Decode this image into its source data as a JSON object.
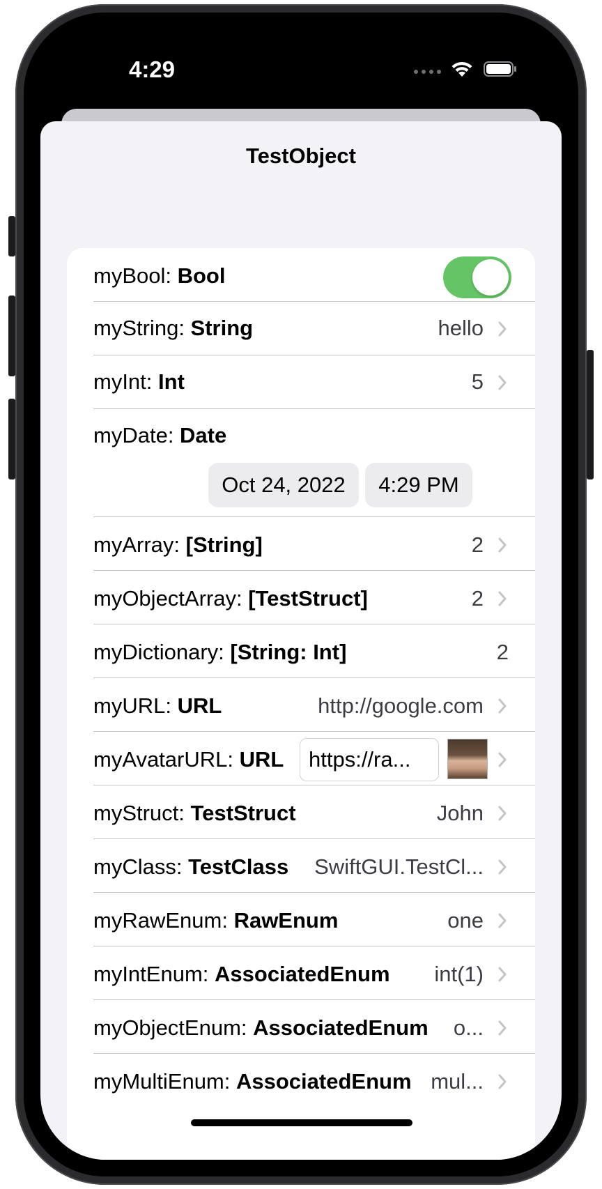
{
  "status_bar": {
    "time": "4:29"
  },
  "nav": {
    "title": "TestObject"
  },
  "rows": [
    {
      "name": "myBool",
      "type": "Bool",
      "kind": "toggle",
      "on": true
    },
    {
      "name": "myString",
      "type": "String",
      "value": "hello"
    },
    {
      "name": "myInt",
      "type": "Int",
      "value": "5"
    },
    {
      "name": "myDate",
      "type": "Date",
      "date": "Oct 24, 2022",
      "time": "4:29 PM"
    },
    {
      "name": "myArray",
      "type": "[String]",
      "value": "2"
    },
    {
      "name": "myObjectArray",
      "type": "[TestStruct]",
      "value": "2"
    },
    {
      "name": "myDictionary",
      "type": "[String: Int]",
      "value": "2"
    },
    {
      "name": "myURL",
      "type": "URL",
      "value": "http://google.com"
    },
    {
      "name": "myAvatarURL",
      "type": "URL",
      "value": "https://ra..."
    },
    {
      "name": "myStruct",
      "type": "TestStruct",
      "value": "John"
    },
    {
      "name": "myClass",
      "type": "TestClass",
      "value": "SwiftGUI.TestCl..."
    },
    {
      "name": "myRawEnum",
      "type": "RawEnum",
      "value": "one"
    },
    {
      "name": "myIntEnum",
      "type": "AssociatedEnum",
      "value": "int(1)"
    },
    {
      "name": "myObjectEnum",
      "type": "AssociatedEnum",
      "value": "o..."
    },
    {
      "name": "myMultiEnum",
      "type": "AssociatedEnum",
      "value": "mul..."
    }
  ],
  "colors": {
    "toggle_on": "#65c466",
    "background": "#f2f2f7",
    "chevron": "#c4c4c7"
  },
  "icons": {
    "chevron": "chevron-right-icon",
    "wifi": "wifi-icon",
    "battery": "battery-icon"
  }
}
